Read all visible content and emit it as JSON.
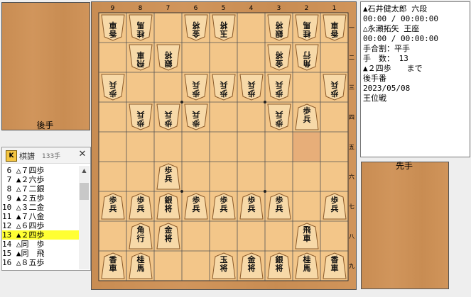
{
  "komadai": {
    "gote_label": "後手",
    "sente_label": "先手"
  },
  "board": {
    "file_labels": [
      "9",
      "8",
      "7",
      "6",
      "5",
      "4",
      "3",
      "2",
      "1"
    ],
    "rank_labels": [
      "一",
      "二",
      "三",
      "四",
      "五",
      "六",
      "七",
      "八",
      "九"
    ],
    "highlight_square": {
      "file": 2,
      "rank": 5
    },
    "pieces": [
      {
        "file": 9,
        "rank": 1,
        "owner": "gote",
        "name": "香車"
      },
      {
        "file": 8,
        "rank": 1,
        "owner": "gote",
        "name": "桂馬"
      },
      {
        "file": 6,
        "rank": 1,
        "owner": "gote",
        "name": "金将"
      },
      {
        "file": 5,
        "rank": 1,
        "owner": "gote",
        "name": "玉将"
      },
      {
        "file": 3,
        "rank": 1,
        "owner": "gote",
        "name": "銀将"
      },
      {
        "file": 2,
        "rank": 1,
        "owner": "gote",
        "name": "桂馬"
      },
      {
        "file": 1,
        "rank": 1,
        "owner": "gote",
        "name": "香車"
      },
      {
        "file": 8,
        "rank": 2,
        "owner": "gote",
        "name": "飛車"
      },
      {
        "file": 7,
        "rank": 2,
        "owner": "gote",
        "name": "銀将"
      },
      {
        "file": 3,
        "rank": 2,
        "owner": "gote",
        "name": "金将"
      },
      {
        "file": 2,
        "rank": 2,
        "owner": "gote",
        "name": "角行"
      },
      {
        "file": 9,
        "rank": 3,
        "owner": "gote",
        "name": "歩兵"
      },
      {
        "file": 6,
        "rank": 3,
        "owner": "gote",
        "name": "歩兵"
      },
      {
        "file": 5,
        "rank": 3,
        "owner": "gote",
        "name": "歩兵"
      },
      {
        "file": 4,
        "rank": 3,
        "owner": "gote",
        "name": "歩兵"
      },
      {
        "file": 3,
        "rank": 3,
        "owner": "gote",
        "name": "歩兵"
      },
      {
        "file": 1,
        "rank": 3,
        "owner": "gote",
        "name": "歩兵"
      },
      {
        "file": 8,
        "rank": 4,
        "owner": "gote",
        "name": "歩兵"
      },
      {
        "file": 7,
        "rank": 4,
        "owner": "gote",
        "name": "歩兵"
      },
      {
        "file": 6,
        "rank": 4,
        "owner": "gote",
        "name": "歩兵"
      },
      {
        "file": 3,
        "rank": 4,
        "owner": "gote",
        "name": "歩兵"
      },
      {
        "file": 2,
        "rank": 4,
        "owner": "sente",
        "name": "歩兵"
      },
      {
        "file": 7,
        "rank": 6,
        "owner": "sente",
        "name": "歩兵"
      },
      {
        "file": 9,
        "rank": 7,
        "owner": "sente",
        "name": "歩兵"
      },
      {
        "file": 8,
        "rank": 7,
        "owner": "sente",
        "name": "歩兵"
      },
      {
        "file": 7,
        "rank": 7,
        "owner": "sente",
        "name": "銀将"
      },
      {
        "file": 6,
        "rank": 7,
        "owner": "sente",
        "name": "歩兵"
      },
      {
        "file": 5,
        "rank": 7,
        "owner": "sente",
        "name": "歩兵"
      },
      {
        "file": 4,
        "rank": 7,
        "owner": "sente",
        "name": "歩兵"
      },
      {
        "file": 3,
        "rank": 7,
        "owner": "sente",
        "name": "歩兵"
      },
      {
        "file": 1,
        "rank": 7,
        "owner": "sente",
        "name": "歩兵"
      },
      {
        "file": 8,
        "rank": 8,
        "owner": "sente",
        "name": "角行"
      },
      {
        "file": 7,
        "rank": 8,
        "owner": "sente",
        "name": "金将"
      },
      {
        "file": 2,
        "rank": 8,
        "owner": "sente",
        "name": "飛車"
      },
      {
        "file": 9,
        "rank": 9,
        "owner": "sente",
        "name": "香車"
      },
      {
        "file": 8,
        "rank": 9,
        "owner": "sente",
        "name": "桂馬"
      },
      {
        "file": 5,
        "rank": 9,
        "owner": "sente",
        "name": "玉将"
      },
      {
        "file": 4,
        "rank": 9,
        "owner": "sente",
        "name": "金将"
      },
      {
        "file": 3,
        "rank": 9,
        "owner": "sente",
        "name": "銀将"
      },
      {
        "file": 2,
        "rank": 9,
        "owner": "sente",
        "name": "桂馬"
      },
      {
        "file": 1,
        "rank": 9,
        "owner": "sente",
        "name": "香車"
      }
    ]
  },
  "info": {
    "lines": [
      "▲石井健太郎 六段",
      "00:00 / 00:00:00",
      "△永瀬拓矢 王座",
      "00:00 / 00:00:00",
      "手合割：平手",
      "手　数： 13",
      "▲２四歩　　まで",
      "後手番",
      "2023/05/08",
      "王位戦"
    ]
  },
  "kifu": {
    "title": "棋譜",
    "count": "133手",
    "logo": "K",
    "close": "✕",
    "scroll_up": "▲",
    "selected_index": 7,
    "moves": [
      " 6 △７四歩",
      " 7 ▲２六歩",
      " 8 △７二銀",
      " 9 ▲２五歩",
      "10 △３二金",
      "11 ▲７八金",
      "12 △６四歩",
      "13 ▲２四歩",
      "14 △同　歩",
      "15 ▲同　飛",
      "16 △８五歩"
    ]
  },
  "colors": {
    "wood": "#cf9155",
    "board": "#f3c689",
    "highlight": "#e7ae79",
    "piece_face": "#f7d9a8",
    "selection": "#ffff33"
  }
}
